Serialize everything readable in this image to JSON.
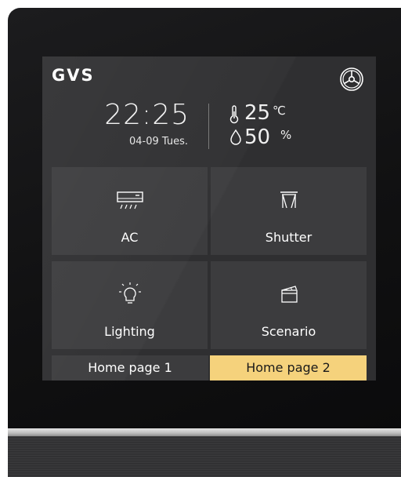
{
  "brand": {
    "logo": "GVS"
  },
  "clock": {
    "time": "22:25",
    "date": "04-09 Tues."
  },
  "climate": {
    "temperature": "25",
    "temperature_unit": "℃",
    "humidity": "50",
    "humidity_unit": "%"
  },
  "tiles": [
    {
      "label": "AC",
      "icon": "air-conditioner-icon"
    },
    {
      "label": "Shutter",
      "icon": "curtain-icon"
    },
    {
      "label": "Lighting",
      "icon": "lightbulb-icon"
    },
    {
      "label": "Scenario",
      "icon": "clapperboard-icon"
    }
  ],
  "pages": [
    {
      "label": "Home page 1",
      "active": false
    },
    {
      "label": "Home page 2",
      "active": true
    }
  ],
  "colors": {
    "screen_bg": "#2f2f31",
    "tile_bg": "#3c3c3e",
    "active_page": "#f5d27c",
    "text": "#ffffff"
  }
}
